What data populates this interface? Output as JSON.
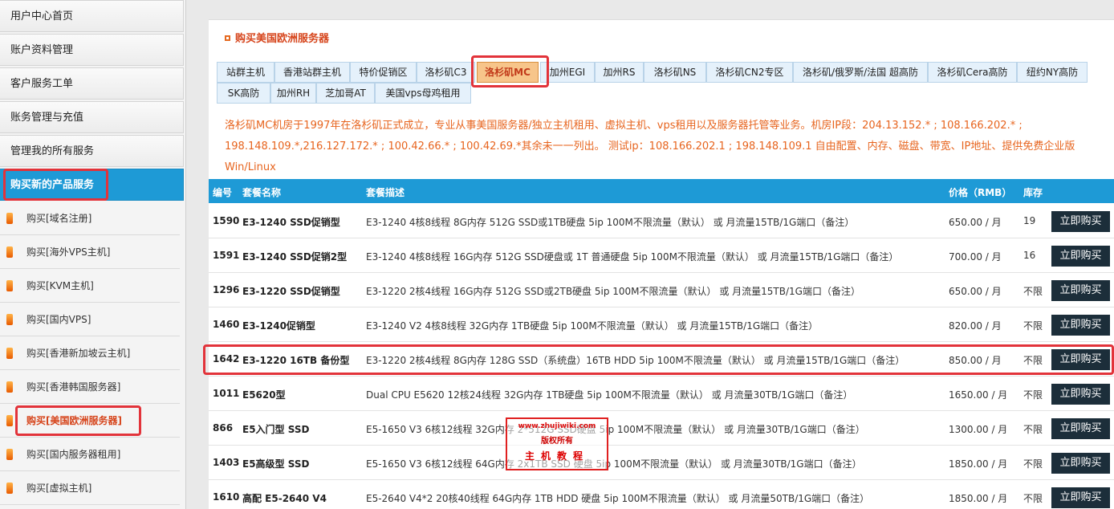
{
  "sidebar": {
    "menu": [
      {
        "label": "用户中心首页"
      },
      {
        "label": "账户资料管理"
      },
      {
        "label": "客户服务工单"
      },
      {
        "label": "账务管理与充值"
      },
      {
        "label": "管理我的所有服务"
      },
      {
        "label": "购买新的产品服务",
        "active": true
      }
    ],
    "sub": [
      {
        "label": "购买[域名注册]"
      },
      {
        "label": "购买[海外VPS主机]"
      },
      {
        "label": "购买[KVM主机]"
      },
      {
        "label": "购买[国内VPS]"
      },
      {
        "label": "购买[香港新加坡云主机]"
      },
      {
        "label": "购买[香港韩国服务器]"
      },
      {
        "label": "购买[美国欧洲服务器]",
        "active": true
      },
      {
        "label": "购买[国内服务器租用]"
      },
      {
        "label": "购买[虚拟主机]"
      }
    ]
  },
  "panel": {
    "title": "购买美国欧洲服务器",
    "tabs": [
      "站群主机",
      "香港站群主机",
      "特价促销区",
      "洛杉矶C3",
      "洛杉矶MC",
      "加州EGI",
      "加州RS",
      "洛杉矶NS",
      "洛杉矶CN2专区",
      "洛杉矶/俄罗斯/法国 超高防",
      "洛杉矶Cera高防",
      "纽约NY高防",
      "SK高防",
      "加州RH",
      "芝加哥AT",
      "美国vps母鸡租用"
    ],
    "active_tab": "洛杉矶MC",
    "description": "洛杉矶MC机房于1997年在洛杉矶正式成立，专业从事美国服务器/独立主机租用、虚拟主机、vps租用以及服务器托管等业务。机房IP段：204.13.152.* ; 108.166.202.* ; 198.148.109.*,216.127.172.* ; 100.42.66.* ; 100.42.69.*其余未一一列出。 测试ip：108.166.202.1 ; 198.148.109.1 自由配置、内存、磁盘、带宽、IP地址、提供免费企业版Win/Linux"
  },
  "table": {
    "headers": {
      "id": "编号",
      "name": "套餐名称",
      "desc": "套餐描述",
      "price": "价格（RMB）",
      "stock": "库存"
    },
    "buy_label": "立即购买",
    "rows": [
      {
        "id": "1590",
        "name": "E3-1240 SSD促销型",
        "desc": "E3-1240 4核8线程 8G内存 512G SSD或1TB硬盘  5ip  100M不限流量（默认） 或 月流量15TB/1G端口（备注）",
        "price": "650.00 / 月",
        "stock": "19"
      },
      {
        "id": "1591",
        "name": "E3-1240 SSD促销2型",
        "desc": "E3-1240 4核8线程 16G内存 512G SSD硬盘或 1T 普通硬盘  5ip 100M不限流量（默认） 或 月流量15TB/1G端口（备注）",
        "price": "700.00 / 月",
        "stock": "16"
      },
      {
        "id": "1296",
        "name": "E3-1220 SSD促销型",
        "desc": "E3-1220 2核4线程 16G内存 512G SSD或2TB硬盘  5ip  100M不限流量（默认） 或 月流量15TB/1G端口（备注）",
        "price": "650.00 / 月",
        "stock": "不限"
      },
      {
        "id": "1460",
        "name": "E3-1240促销型",
        "desc": "E3-1240 V2 4核8线程 32G内存 1TB硬盘  5ip 100M不限流量（默认） 或 月流量15TB/1G端口（备注）",
        "price": "820.00 / 月",
        "stock": "不限"
      },
      {
        "id": "1642",
        "name": "E3-1220 16TB 备份型",
        "desc": "E3-1220 2核4线程 8G内存 128G SSD（系统盘）16TB HDD  5ip  100M不限流量（默认） 或 月流量15TB/1G端口（备注）",
        "price": "850.00 / 月",
        "stock": "不限",
        "highlight": true
      },
      {
        "id": "1011",
        "name": "E5620型",
        "desc": "Dual CPU E5620 12核24线程 32G内存 1TB硬盘 5ip 100M不限流量（默认） 或 月流量30TB/1G端口（备注）",
        "price": "1650.00 / 月",
        "stock": "不限"
      },
      {
        "id": "866",
        "name": "E5入门型 SSD",
        "desc": "E5-1650 V3 6核12线程 32G内存 2*512G SSD硬盘 5ip 100M不限流量（默认） 或 月流量30TB/1G端口（备注）",
        "price": "1300.00 / 月",
        "stock": "不限"
      },
      {
        "id": "1403",
        "name": "E5高级型 SSD",
        "desc": "E5-1650 V3 6核12线程 64G内存 2x1TB SSD 硬盘 5ip 100M不限流量（默认） 或 月流量30TB/1G端口（备注）",
        "price": "1850.00 / 月",
        "stock": "不限"
      },
      {
        "id": "1610",
        "name": "高配 E5-2640 V4",
        "desc": "E5-2640 V4*2 20核40线程 64G内存 1TB HDD 硬盘 5ip 100M不限流量（默认） 或 月流量50TB/1G端口（备注）",
        "price": "1850.00 / 月",
        "stock": "不限"
      }
    ]
  },
  "watermark": {
    "line1": "www.zhujiwiki.com",
    "line2": "版权所有",
    "line3": "主机教程"
  },
  "colors": {
    "accent": "#1e9ad6",
    "highlight": "#e2333a",
    "orange_text": "#e7641e",
    "button": "#1c2e3a"
  }
}
